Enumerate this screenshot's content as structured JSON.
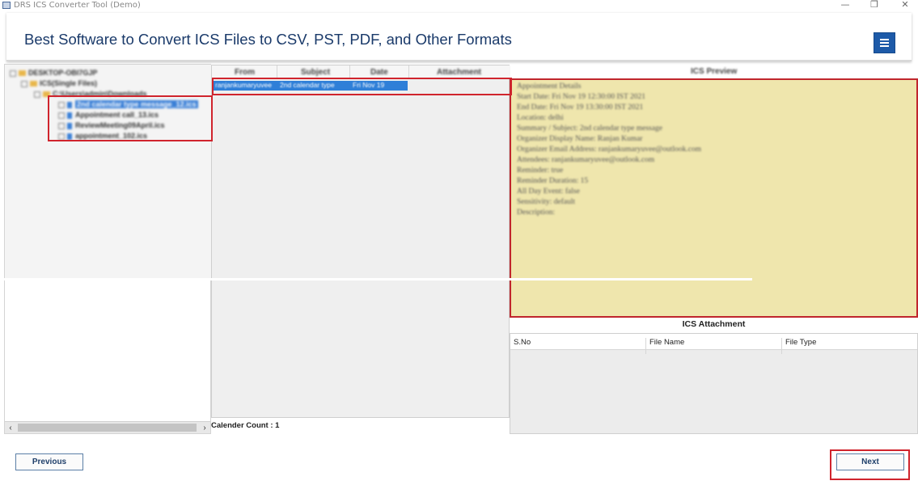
{
  "window": {
    "title": "DRS ICS Converter Tool (Demo)",
    "minimize": "—",
    "restore": "❐",
    "close": "✕"
  },
  "header": {
    "title": "Best Software to Convert ICS Files to CSV, PST, PDF, and Other Formats",
    "menu_icon": "hamburger-icon"
  },
  "tree": {
    "items": [
      {
        "label": "DESKTOP-OBI7GJP",
        "level": 0
      },
      {
        "label": "ICS(Single Files)",
        "level": 1
      },
      {
        "label": "C:\\Users\\admin\\Downloads",
        "level": 2
      },
      {
        "label": "2nd calendar type message_12.ics",
        "level": 3,
        "selected": true
      },
      {
        "label": "Appointment call_13.ics",
        "level": 3
      },
      {
        "label": "ReviewMeeting09April.ics",
        "level": 3
      },
      {
        "label": "appointment_102.ics",
        "level": 3
      }
    ],
    "scroll_left": "‹",
    "scroll_right": "›"
  },
  "mail_list": {
    "columns": [
      "From",
      "Subject",
      "Date",
      "Attachment"
    ],
    "rows": [
      {
        "from": "ranjankumaryuvee",
        "subject": "2nd calendar type",
        "date": "Fri Nov 19"
      }
    ],
    "calendar_count": "Calender Count : 1"
  },
  "preview": {
    "title": "ICS Preview",
    "lines": [
      "Appointment Details",
      "Start Date: Fri Nov 19 12:30:00 IST 2021",
      "End Date: Fri Nov 19 13:30:00 IST 2021",
      "Location: delhi",
      "Summary / Subject: 2nd calendar type message",
      "Organizer Display Name: Ranjan Kumar",
      "Organizer Email Address: ranjankumaryuvee@outlook.com",
      "Attendees: ranjankumaryuvee@outlook.com",
      "Reminder: true",
      "Reminder Duration: 15",
      "All Day Event: false",
      "Sensitivity: default",
      "Description:"
    ]
  },
  "attachment": {
    "title": "ICS Attachment",
    "columns": [
      "S.No",
      "File Name",
      "File Type"
    ]
  },
  "footer": {
    "previous_label": "Previous",
    "next_label": "Next"
  },
  "colors": {
    "accent": "#1d5aa8",
    "highlight": "#d0242d",
    "preview_bg": "#efe6ad",
    "selection": "#2f7fd8"
  }
}
